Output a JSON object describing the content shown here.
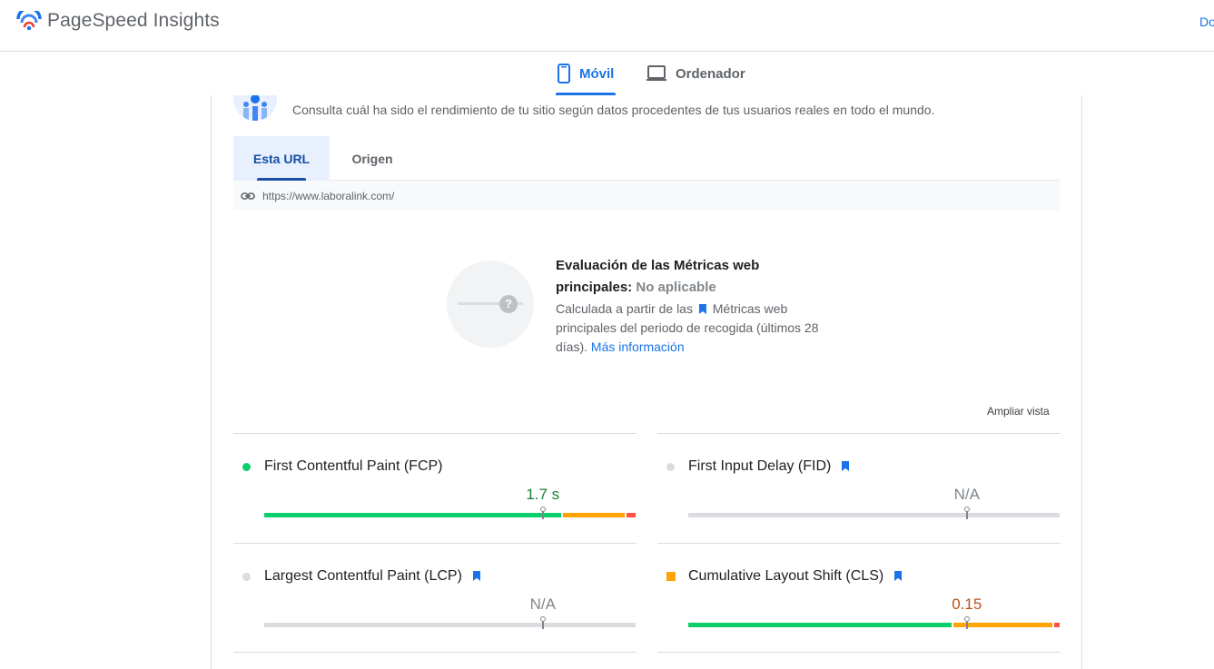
{
  "header": {
    "title": "PageSpeed Insights",
    "right_link": "Do"
  },
  "device_tabs": [
    {
      "label": "Móvil",
      "active": true
    },
    {
      "label": "Ordenador",
      "active": false
    }
  ],
  "crux": {
    "description": "Consulta cuál ha sido el rendimiento de tu sitio según datos procedentes de tus usuarios reales en todo el mundo.",
    "tabs": [
      {
        "label": "Esta URL",
        "active": true
      },
      {
        "label": "Origen",
        "active": false
      }
    ],
    "url": "https://www.laboralink.com/"
  },
  "assessment": {
    "title": "Evaluación de las Métricas web principales:",
    "status": "No aplicable",
    "body_prefix": "Calculada a partir de las",
    "body_link_term": "Métricas web principales del periodo de recogida (últimos 28 días).",
    "more_info": "Más información"
  },
  "expand_label": "Ampliar vista",
  "metrics": [
    {
      "name": "First Contentful Paint (FCP)",
      "value": "1.7 s",
      "status": "good",
      "position": 0.75,
      "has_bookmark": false,
      "distribution": [
        0.8,
        0.17,
        0.03
      ]
    },
    {
      "name": "First Input Delay (FID)",
      "value": "N/A",
      "status": "none",
      "position": 0.75,
      "has_bookmark": true
    },
    {
      "name": "Largest Contentful Paint (LCP)",
      "value": "N/A",
      "status": "none",
      "position": 0.75,
      "has_bookmark": true
    },
    {
      "name": "Cumulative Layout Shift (CLS)",
      "value": "0.15",
      "status": "average",
      "position": 0.75,
      "has_bookmark": true,
      "distribution": [
        0.71,
        0.27,
        0.02
      ]
    }
  ],
  "colors": {
    "accent": "#1a73e8",
    "good": "#0cce6b",
    "average": "#ffa400",
    "poor": "#ff4e42",
    "none": "#dadce0",
    "value_good": "#188038",
    "value_average": "#b3531d",
    "value_none": "#80868b"
  }
}
